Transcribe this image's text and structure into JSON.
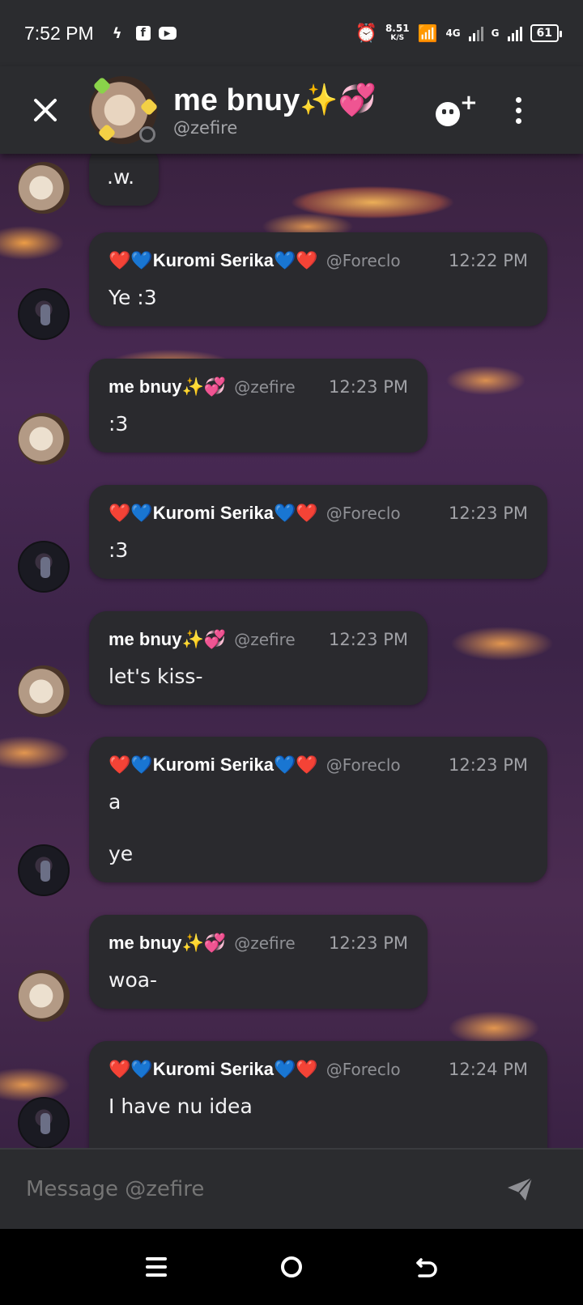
{
  "status_bar": {
    "time": "7:52 PM",
    "speed_value": "8.51",
    "speed_unit": "K/S",
    "network_4g": "4G",
    "network_g": "G",
    "battery": "61"
  },
  "header": {
    "title": "me bnuy✨💞",
    "handle": "@zefire"
  },
  "messages": [
    {
      "author": "",
      "handle": "",
      "time": "",
      "lines": [
        ".w."
      ]
    },
    {
      "author": "❤️💙Kuromi Serika💙❤️",
      "handle": "@Foreclo",
      "time": "12:22 PM",
      "lines": [
        "Ye :3"
      ]
    },
    {
      "author": "me bnuy✨💞",
      "handle": "@zefire",
      "time": "12:23 PM",
      "lines": [
        ":3"
      ]
    },
    {
      "author": "❤️💙Kuromi Serika💙❤️",
      "handle": "@Foreclo",
      "time": "12:23 PM",
      "lines": [
        ":3"
      ]
    },
    {
      "author": "me bnuy✨💞",
      "handle": "@zefire",
      "time": "12:23 PM",
      "lines": [
        "let's kiss-"
      ]
    },
    {
      "author": "❤️💙Kuromi Serika💙❤️",
      "handle": "@Foreclo",
      "time": "12:23 PM",
      "lines": [
        "a",
        "ye"
      ]
    },
    {
      "author": "me bnuy✨💞",
      "handle": "@zefire",
      "time": "12:23 PM",
      "lines": [
        "woa-"
      ]
    },
    {
      "author": "❤️💙Kuromi Serika💙❤️",
      "handle": "@Foreclo",
      "time": "12:24 PM",
      "lines": [
        "I have nu idea"
      ]
    }
  ],
  "composer": {
    "placeholder": "Message @zefire"
  },
  "icons": {
    "close": "close-icon",
    "add_friend": "add-friend-icon",
    "more": "more-vertical-icon",
    "send": "send-icon",
    "nav_menu": "menu-icon",
    "nav_home": "home-icon",
    "nav_back": "back-icon"
  }
}
